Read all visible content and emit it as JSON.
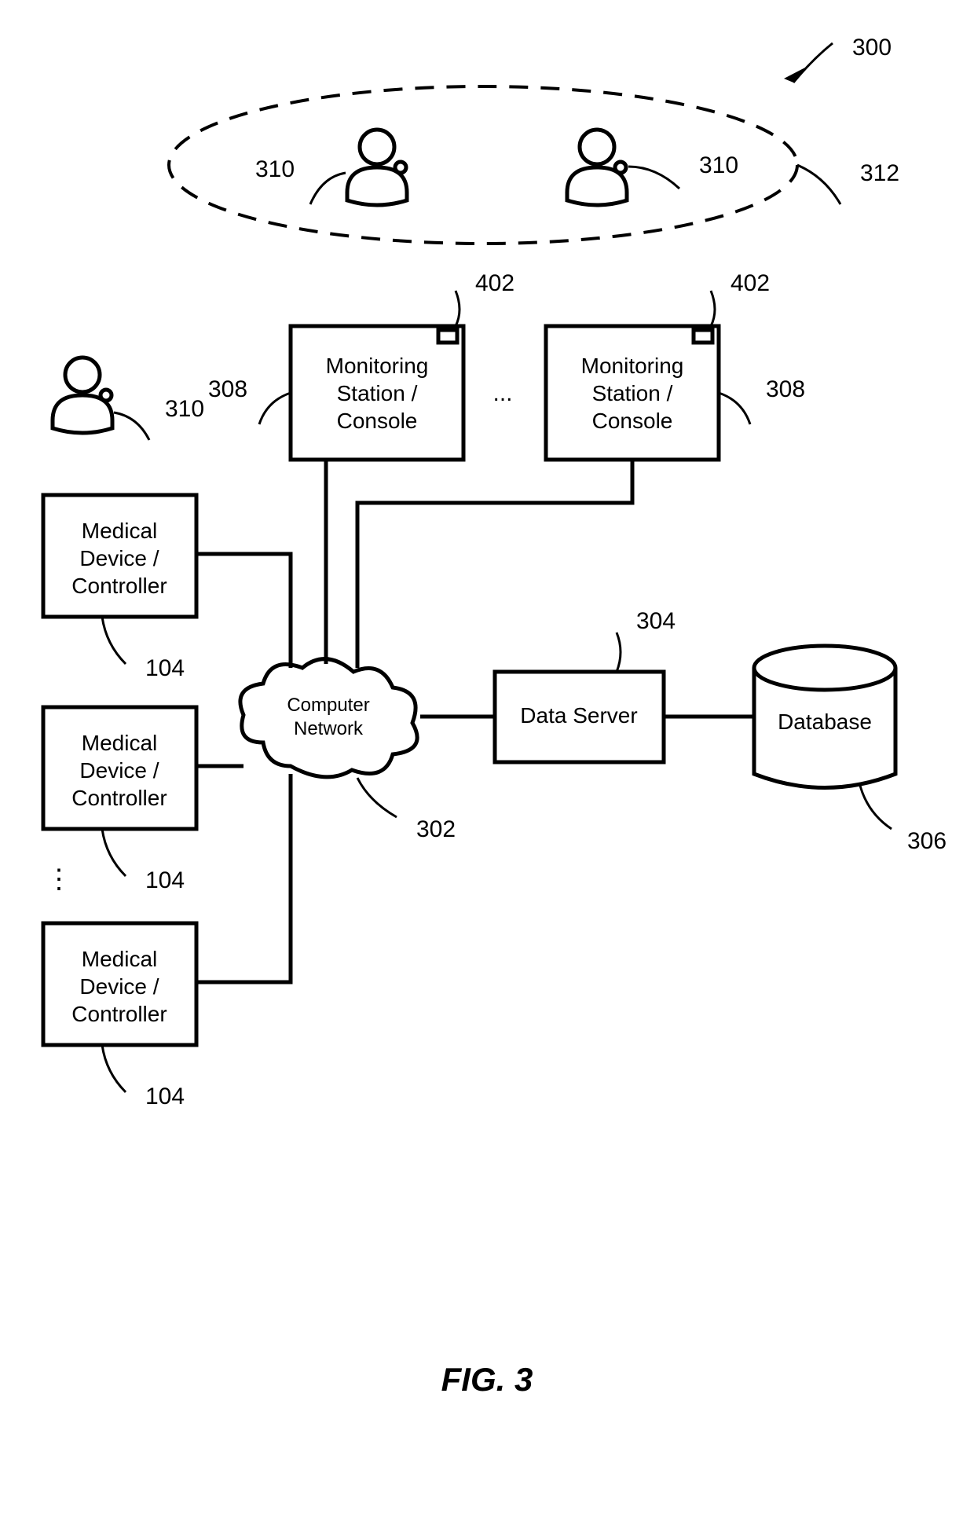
{
  "figure_label": "FIG. 3",
  "refs": {
    "system": "300",
    "network": "302",
    "data_server": "304",
    "database": "306",
    "monitoring_station_left": "308",
    "monitoring_station_right": "308",
    "indicator_left": "402",
    "indicator_right": "402",
    "user_left": "310",
    "user_mid": "310",
    "user_right": "310",
    "group": "312",
    "device_1": "104",
    "device_2": "104",
    "device_3": "104"
  },
  "labels": {
    "monitoring_station": [
      "Monitoring",
      "Station /",
      "Console"
    ],
    "medical_device": [
      "Medical",
      "Device /",
      "Controller"
    ],
    "computer_network": [
      "Computer",
      "Network"
    ],
    "data_server": "Data Server",
    "database": "Database",
    "ellipsis_h": "...",
    "ellipsis_v": "⋮"
  }
}
